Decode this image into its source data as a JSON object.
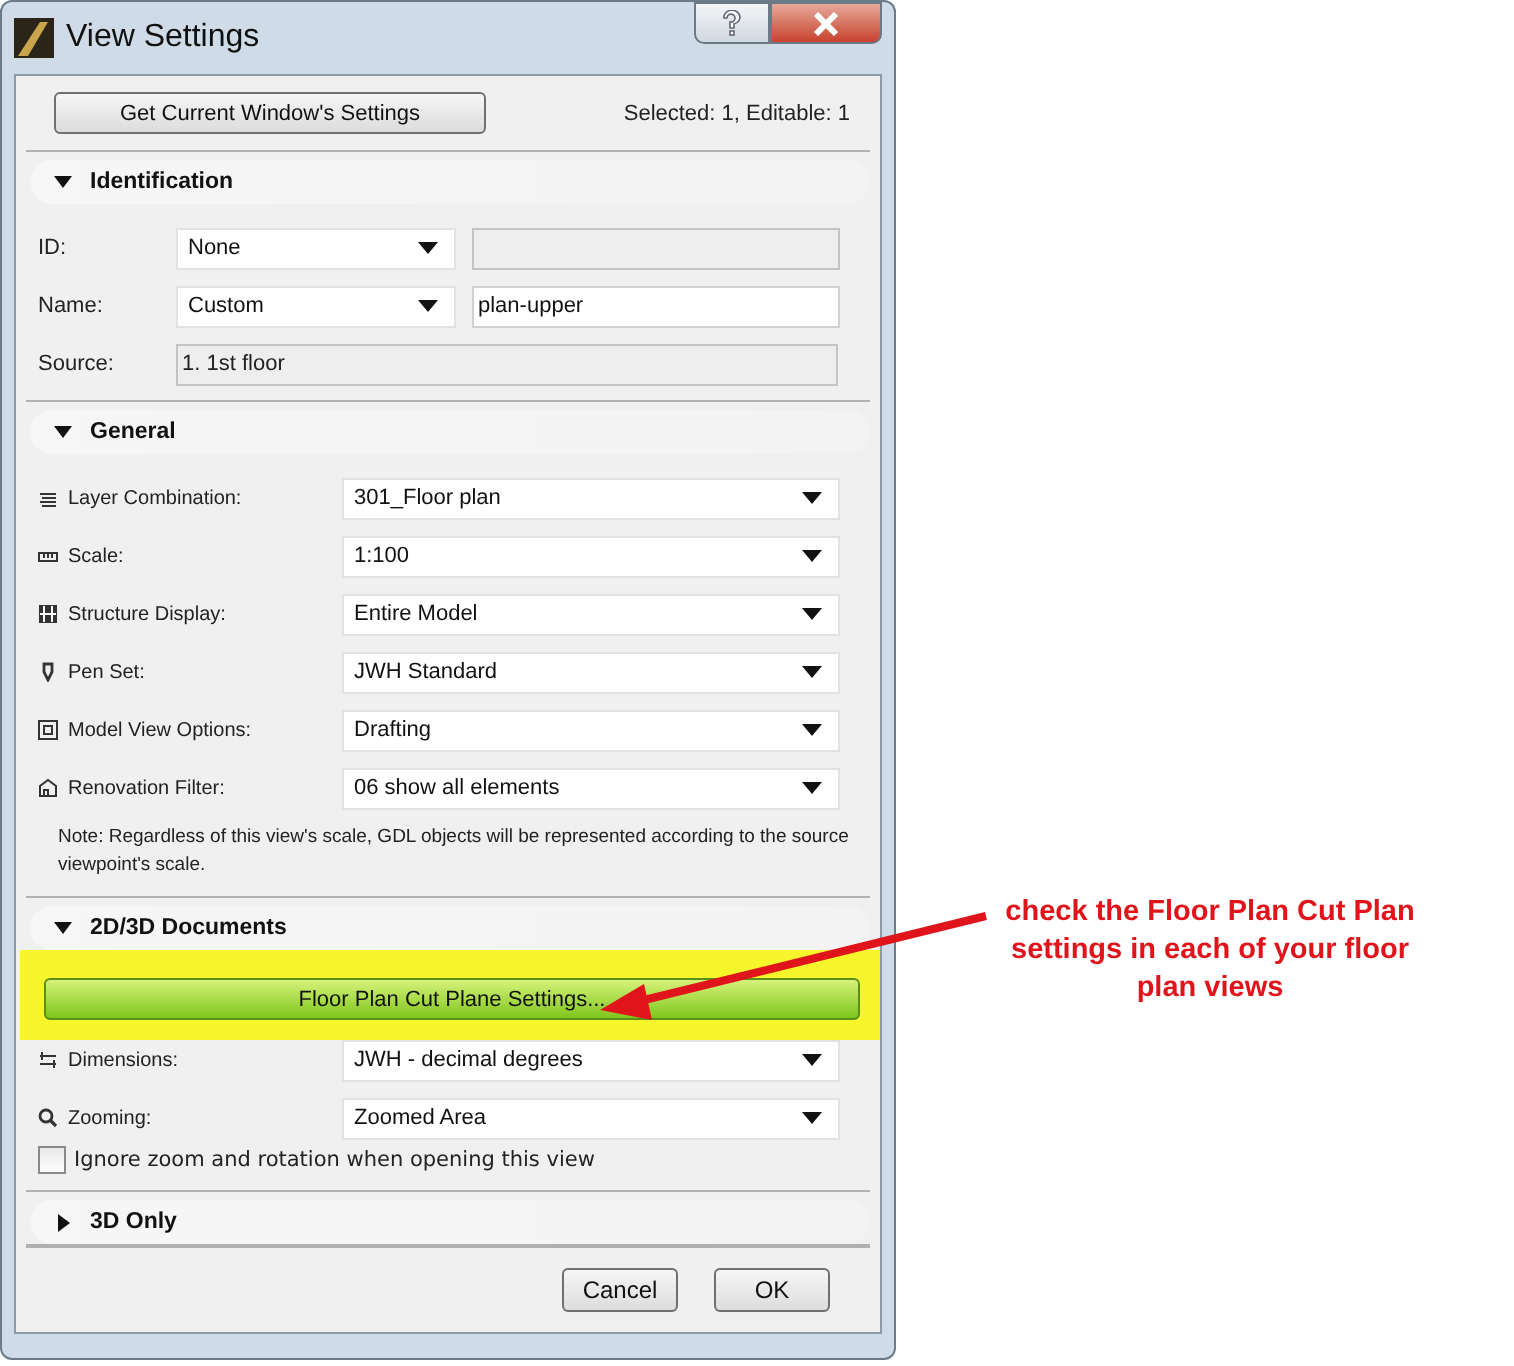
{
  "window": {
    "title": "View Settings"
  },
  "top_button": "Get Current Window's Settings",
  "selection_info": "Selected: 1, Editable: 1",
  "sections": [
    {
      "title": "Identification",
      "expanded": true,
      "rows": [
        {
          "kind": "select_field",
          "label": "ID:",
          "value": "None",
          "field": {
            "disabled": true
          }
        },
        {
          "kind": "select_field",
          "label": "Name:",
          "value": "Custom",
          "field": {
            "value": "plan-upper",
            "disabled": false
          }
        },
        {
          "kind": "readonly",
          "label": "Source:",
          "field": {
            "value": "1. 1st floor",
            "disabled": true
          }
        }
      ]
    },
    {
      "title": "General",
      "expanded": true,
      "rows": [
        {
          "kind": "select",
          "label": "Layer Combination:",
          "value": "301_Floor plan"
        },
        {
          "kind": "select",
          "label": "Scale:",
          "value": "1:100"
        },
        {
          "kind": "select",
          "label": "Structure Display:",
          "value": "Entire Model"
        },
        {
          "kind": "select",
          "label": "Pen Set:",
          "value": "JWH Standard"
        },
        {
          "kind": "select",
          "label": "Model View Options:",
          "value": "Drafting"
        },
        {
          "kind": "select",
          "label": "Renovation Filter:",
          "value": "06 show all elements"
        },
        {
          "kind": "note",
          "text": "Note: Regardless of this view's scale, GDL objects will be represented according to the source viewpoint's scale."
        }
      ]
    },
    {
      "title": "2D/3D Documents",
      "expanded": true,
      "rows": [
        {
          "kind": "button",
          "label": "Floor Plan Cut Plane Settings...",
          "highlighted": true
        },
        {
          "kind": "select",
          "label": "Dimensions:",
          "value": "JWH - decimal degrees"
        },
        {
          "kind": "select",
          "label": "Zooming:",
          "value": "Zoomed Area"
        },
        {
          "kind": "checkbox",
          "label": "Ignore zoom and rotation when opening this view",
          "checked": false
        }
      ]
    },
    {
      "title": "3D Only",
      "expanded": false
    }
  ],
  "buttons": [
    "Cancel",
    "OK"
  ],
  "annotation": {
    "text": "check the Floor Plan Cut Plan settings in each of your floor plan views"
  }
}
